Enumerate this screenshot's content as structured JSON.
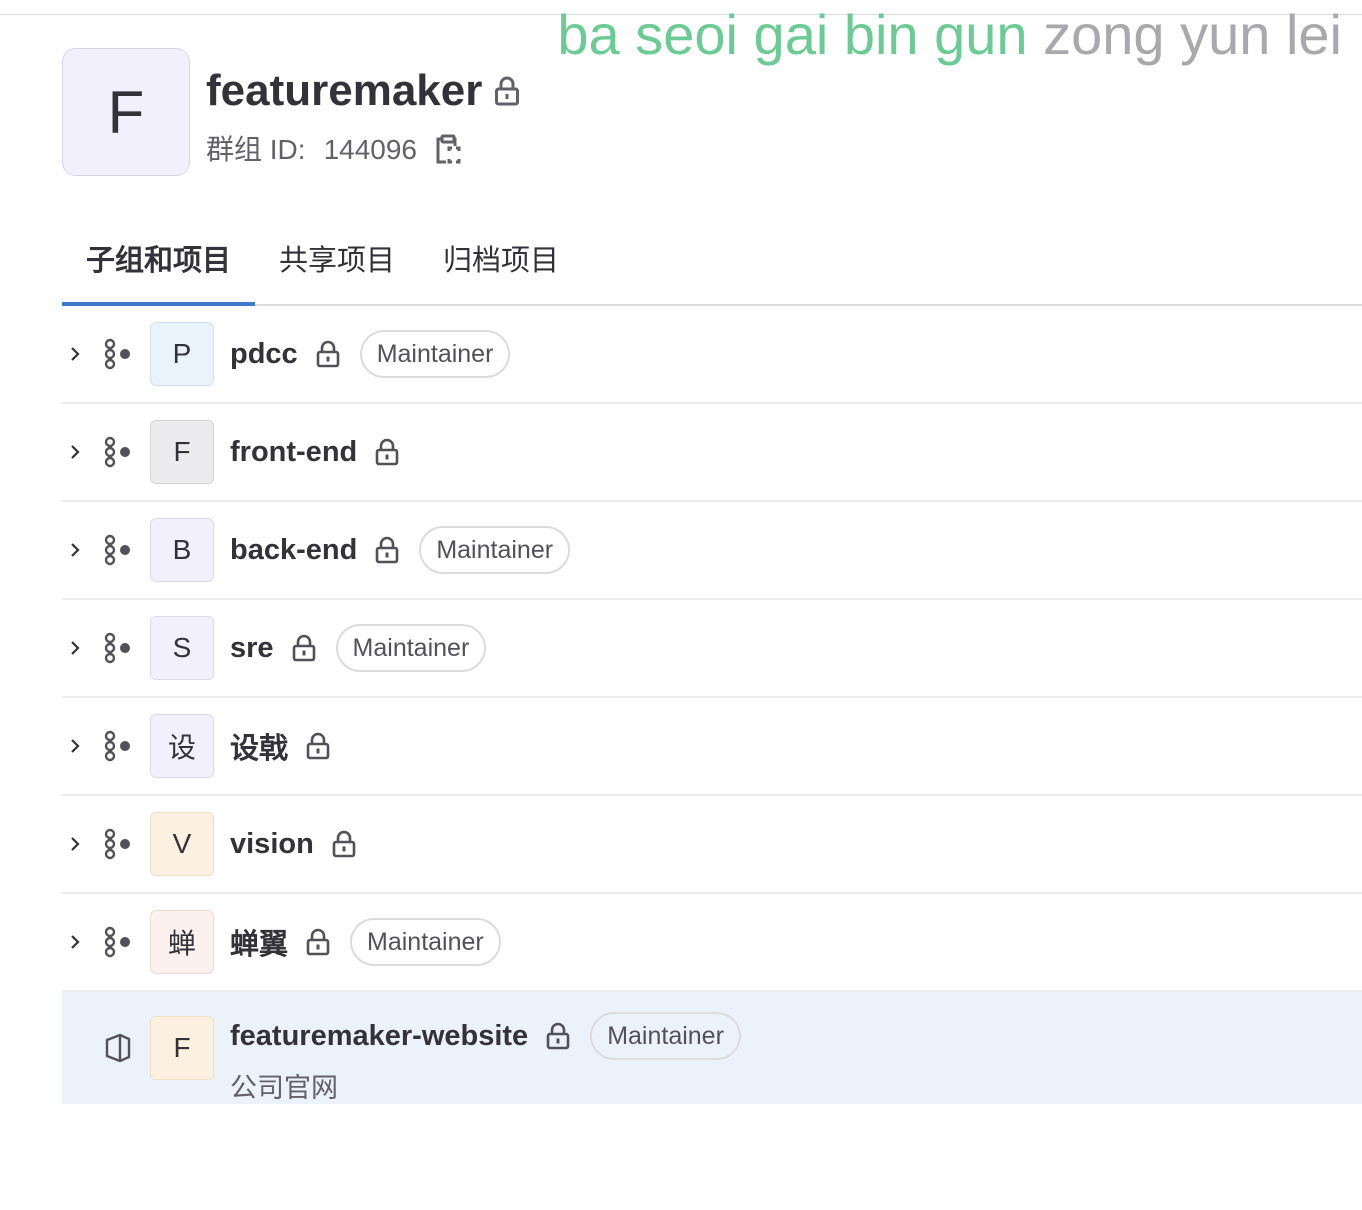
{
  "overlay": {
    "part1": "ba seoi gai bin gun",
    "part2": "zong yun lei"
  },
  "group": {
    "avatar_letter": "F",
    "name": "featuremaker",
    "id_label": "群组 ID:",
    "id_value": "144096"
  },
  "tabs": [
    {
      "label": "子组和项目",
      "active": true
    },
    {
      "label": "共享项目",
      "active": false
    },
    {
      "label": "归档项目",
      "active": false
    }
  ],
  "subgroups": [
    {
      "avatar": "P",
      "name": "pdcc",
      "role": "Maintainer"
    },
    {
      "avatar": "F",
      "name": "front-end",
      "role": ""
    },
    {
      "avatar": "B",
      "name": "back-end",
      "role": "Maintainer"
    },
    {
      "avatar": "S",
      "name": "sre",
      "role": "Maintainer"
    },
    {
      "avatar": "设",
      "name": "设戟",
      "role": ""
    },
    {
      "avatar": "V",
      "name": "vision",
      "role": ""
    },
    {
      "avatar": "蝉",
      "name": "蝉翼",
      "role": "Maintainer"
    }
  ],
  "project": {
    "avatar": "F",
    "name": "featuremaker-website",
    "role": "Maintainer",
    "description": "公司官网"
  },
  "colors": {
    "tab_active_underline": "#3e78c9",
    "highlight_row": "#ebf2fa",
    "overlay_green": "#6ccb95"
  },
  "icons": [
    "lock-icon",
    "copy-icon",
    "chevron-right-icon",
    "subgroup-icon",
    "project-icon"
  ]
}
